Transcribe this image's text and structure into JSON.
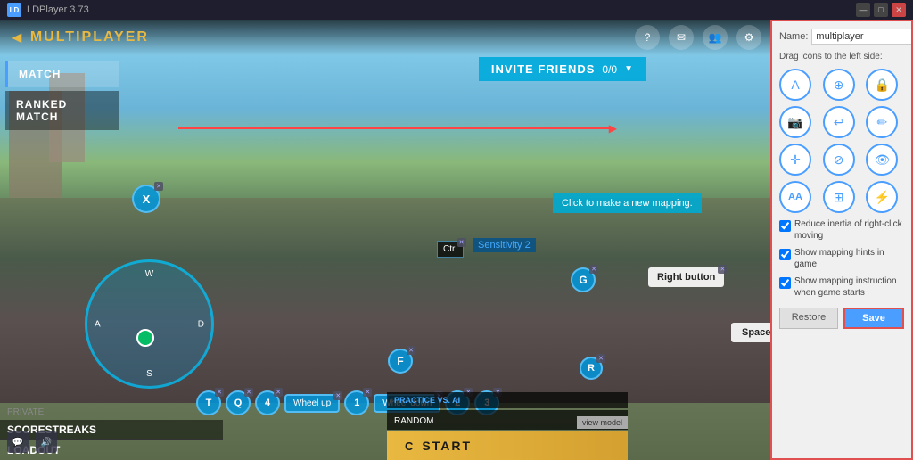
{
  "titlebar": {
    "title": "LDPlayer 3.73",
    "logo": "LD",
    "controls": [
      "—",
      "□",
      "✕"
    ]
  },
  "game": {
    "back_label": "MULTIPLAYER",
    "nav_tabs": [
      {
        "label": "MATCH",
        "active": true
      },
      {
        "label": "RANKED MATCH",
        "active": false
      }
    ],
    "invite_friends_label": "INVITE FRIENDS",
    "invite_count": "0/0",
    "new_mapping_tooltip": "Click to make a new mapping.",
    "keys": {
      "x": "X",
      "ctrl": "Ctrl",
      "sensitivity": "Sensitivity 2",
      "g": "G",
      "right_button": "Right button",
      "space": "Space",
      "f": "F",
      "r": "R",
      "t": "T",
      "q": "Q",
      "num4": "4",
      "wheel_up": "Wheel up",
      "num1": "1",
      "wheel_down": "Wheel down",
      "num2": "2",
      "num3": "3"
    },
    "joystick_labels": {
      "w": "W",
      "s": "S",
      "a": "A",
      "d": "D"
    },
    "bottom_nav": [
      {
        "label": "PRIVATE"
      },
      {
        "label": "SCORESTREAKS"
      },
      {
        "label": "LOADOUT"
      }
    ],
    "practice_label": "PRACTICE VS. AI",
    "random_label": "RANDOM",
    "start_label": "START",
    "view_model_label": "view model"
  },
  "panel": {
    "name_label": "Name:",
    "name_value": "multiplayer",
    "drag_label": "Drag icons to the left side:",
    "icons": [
      {
        "symbol": "A",
        "name": "letter-a-icon"
      },
      {
        "symbol": "⊕",
        "name": "crosshair-icon"
      },
      {
        "symbol": "🔒",
        "name": "lock-icon"
      },
      {
        "symbol": "☁",
        "name": "camera-icon"
      },
      {
        "symbol": "↩",
        "name": "swipe-icon"
      },
      {
        "symbol": "✏",
        "name": "pen-icon"
      },
      {
        "symbol": "✛",
        "name": "dpad-icon"
      },
      {
        "symbol": "⊘",
        "name": "no-icon"
      },
      {
        "symbol": "👁",
        "name": "eye-icon"
      },
      {
        "symbol": "AA",
        "name": "text-aa-icon"
      },
      {
        "symbol": "⊞",
        "name": "grid-icon"
      },
      {
        "symbol": "⚡",
        "name": "bolt-icon"
      }
    ],
    "checkboxes": [
      {
        "label": "Reduce inertia of right-click moving",
        "checked": true
      },
      {
        "label": "Show mapping hints in game",
        "checked": true
      },
      {
        "label": "Show mapping instruction when game starts",
        "checked": true
      }
    ],
    "restore_label": "Restore",
    "save_label": "Save"
  }
}
